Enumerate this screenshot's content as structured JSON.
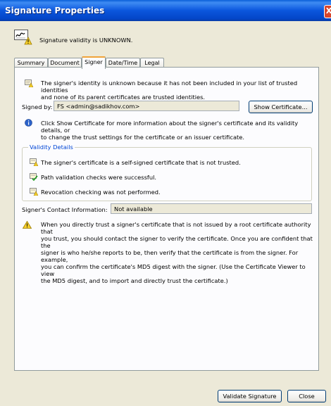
{
  "window": {
    "title": "Signature Properties",
    "close_glyph": "X"
  },
  "header": {
    "status_text": "Signature validity is UNKNOWN.",
    "icon": "signature-warning-icon"
  },
  "tabs": [
    {
      "label": "Summary",
      "active": false
    },
    {
      "label": "Document",
      "active": false
    },
    {
      "label": "Signer",
      "active": true
    },
    {
      "label": "Date/Time",
      "active": false
    },
    {
      "label": "Legal",
      "active": false
    }
  ],
  "signer": {
    "identity_line1": "The signer's identity is unknown because it has not been included in your list of trusted identities",
    "identity_line2": "and none of its parent certificates are trusted identities.",
    "signed_by_label": "Signed by:",
    "signed_by_value": "FS <admin@sadikhov.com>",
    "show_certificate_label": "Show Certificate...",
    "info_line1": "Click Show Certificate for more information about the signer's certificate and its validity details, or",
    "info_line2": "to change the trust settings for the certificate or an issuer certificate.",
    "validity_group_label": "Validity Details",
    "validity_items": [
      {
        "text": "The signer's certificate is a self-signed certificate that is not trusted.",
        "icon": "certificate-warning-icon"
      },
      {
        "text": "Path validation checks were successful.",
        "icon": "certificate-check-icon"
      },
      {
        "text": "Revocation checking was not performed.",
        "icon": "certificate-warning-icon"
      }
    ],
    "contact_label": "Signer's Contact Information:",
    "contact_value": "Not available",
    "warning_lines": [
      "When you directly trust a signer's certificate that is not issued by a root certificate authority that",
      "you trust, you should contact the signer to verify the certificate. Once you are confident that the",
      "signer is who he/she reports to be, then verify that the certificate is from the signer. For example,",
      "you can confirm the certificate's MD5 digest with the signer. (Use the Certificate Viewer to view",
      "the MD5 digest, and to import and directly trust the certificate.)"
    ]
  },
  "footer": {
    "validate_label": "Validate Signature",
    "close_label": "Close"
  },
  "colors": {
    "title_bar": "#0a5fd8",
    "dialog_bg": "#ece9d8",
    "group_label": "#0046d5"
  }
}
